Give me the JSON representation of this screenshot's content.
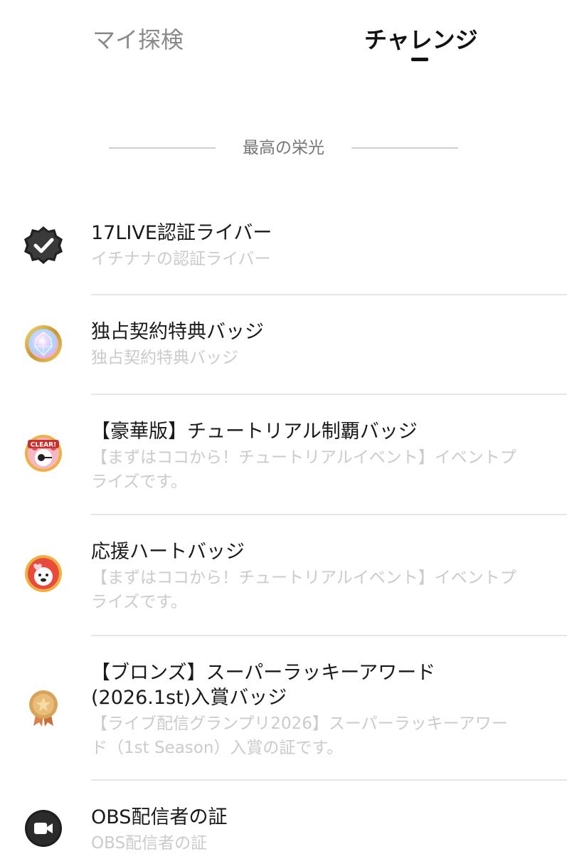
{
  "tabs": {
    "my_exploration": "マイ探検",
    "challenge": "チャレンジ",
    "active": "challenge"
  },
  "section": {
    "title": "最高の栄光"
  },
  "badges": [
    {
      "icon": "verified-badge-icon",
      "title": "17LIVE認証ライバー",
      "description": "イチナナの認証ライバー"
    },
    {
      "icon": "crystal-badge-icon",
      "title": "独占契約特典バッジ",
      "description": "独占契約特典バッジ"
    },
    {
      "icon": "clear-badge-icon",
      "title": "【豪華版】チュートリアル制覇バッジ",
      "description": "【まずはココから！チュートリアルイベント】イベントプライズです。"
    },
    {
      "icon": "heart-badge-icon",
      "title": "応援ハートバッジ",
      "description": "【まずはココから！チュートリアルイベント】イベントプライズです。"
    },
    {
      "icon": "bronze-medal-icon",
      "title": "【ブロンズ】スーパーラッキーアワード(2026.1st)入賞バッジ",
      "description": "【ライブ配信グランプリ2026】スーパーラッキーアワード（1st Season）入賞の証です。"
    },
    {
      "icon": "video-camera-icon",
      "title": "OBS配信者の証",
      "description": "OBS配信者の証"
    }
  ],
  "icon_badge_text": "CLEAR!"
}
